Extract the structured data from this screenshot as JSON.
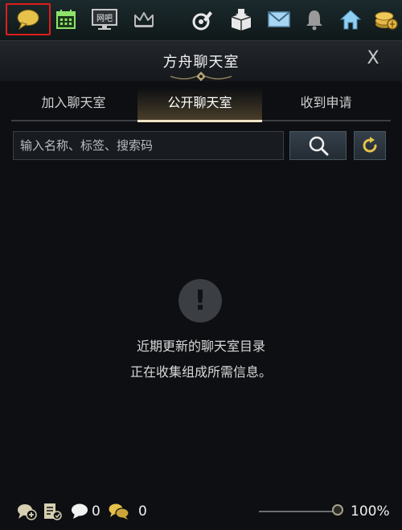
{
  "topbar": {
    "icons": [
      {
        "name": "chat-bubble-icon",
        "color": "#e6c24a"
      },
      {
        "name": "calendar-icon",
        "color": "#8ee36a"
      },
      {
        "name": "monitor-icon",
        "color": "#c8c8c8"
      },
      {
        "name": "crown-icon",
        "color": "#b8b8b8"
      },
      {
        "name": "guild-icon",
        "color": "#e8e8e8"
      },
      {
        "name": "box-icon",
        "color": "#e8e8e8"
      },
      {
        "name": "mail-icon",
        "color": "#a8d4f2"
      },
      {
        "name": "bell-icon",
        "color": "#9a9a9a"
      },
      {
        "name": "home-icon",
        "color": "#8fd0f2"
      },
      {
        "name": "coins-icon",
        "color": "#e6b84a"
      }
    ],
    "monitor_label": "网吧",
    "highlight_color": "#e31b1b"
  },
  "panel": {
    "title": "方舟聊天室",
    "close_label": "X"
  },
  "tabs": [
    {
      "label": "加入聊天室",
      "active": false
    },
    {
      "label": "公开聊天室",
      "active": true
    },
    {
      "label": "收到申请",
      "active": false
    }
  ],
  "search": {
    "placeholder": "输入名称、标签、搜索码",
    "value": ""
  },
  "empty_state": {
    "icon_glyph": "!",
    "line1": "近期更新的聊天室目录",
    "line2": "正在收集组成所需信息。"
  },
  "footer": {
    "chat_count": "0",
    "request_count": "0",
    "zoom_level": 1.0,
    "zoom_label": "100%"
  }
}
